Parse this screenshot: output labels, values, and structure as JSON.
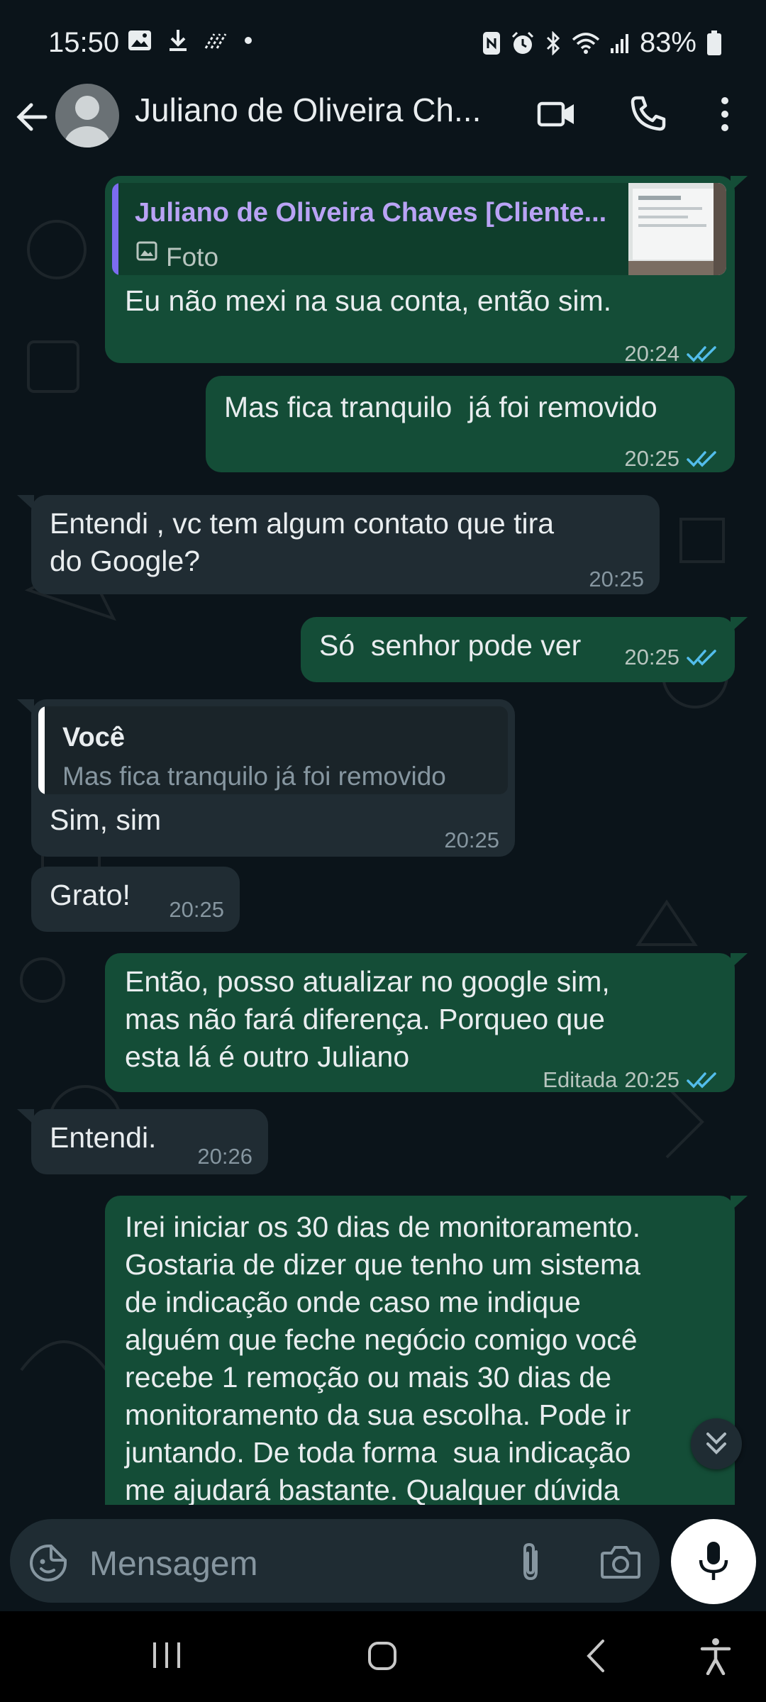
{
  "status_bar": {
    "time": "15:50",
    "battery": "83%",
    "icons": [
      "gallery-icon",
      "download-icon",
      "data-saver-icon",
      "dot-icon",
      "nfc-icon",
      "alarm-icon",
      "bluetooth-icon",
      "wifi-icon",
      "signal-icon",
      "battery-icon"
    ]
  },
  "header": {
    "contact_name": "Juliano de Oliveira Ch...",
    "icons": [
      "back-arrow-icon",
      "avatar-icon",
      "video-call-icon",
      "voice-call-icon",
      "more-options-icon"
    ]
  },
  "messages": [
    {
      "direction": "out",
      "quote": {
        "name": "Juliano de Oliveira Chaves [Cliente...",
        "label": "Foto",
        "name_color": "#b9a3f5",
        "bar_color": "#7c6cf0"
      },
      "text": "Eu não mexi na sua conta, então sim.",
      "time": "20:24",
      "status": "read"
    },
    {
      "direction": "out",
      "text": "Mas fica tranquilo  já foi removido",
      "time": "20:25",
      "status": "read"
    },
    {
      "direction": "in",
      "text": "Entendi , vc tem algum contato que tira\ndo Google?",
      "time": "20:25"
    },
    {
      "direction": "out",
      "text": "Só  senhor pode ver",
      "time": "20:25",
      "status": "read"
    },
    {
      "direction": "in",
      "quote": {
        "name": "Você",
        "text": "Mas fica tranquilo  já foi removido",
        "name_color": "#e9edef",
        "bar_color": "#ffffff"
      },
      "text": "Sim, sim",
      "time": "20:25"
    },
    {
      "direction": "in",
      "text": "Grato!",
      "time": "20:25"
    },
    {
      "direction": "out",
      "text": "Então, posso atualizar no google sim,\nmas não fará diferença. Porqueo que\nesta lá é outro Juliano",
      "edited_label": "Editada",
      "time": "20:25",
      "status": "read"
    },
    {
      "direction": "in",
      "text": "Entendi.",
      "time": "20:26"
    },
    {
      "direction": "out",
      "text": "Irei iniciar os 30 dias de monitoramento.\nGostaria de dizer que tenho um sistema\nde indicação onde caso me indique\nalguém que feche negócio comigo você\nrecebe 1 remoção ou mais 30 dias de\nmonitoramento da sua escolha. Pode ir\njuntando. De toda forma  sua indicação\nme ajudará bastante. Qualquer dúvida"
    }
  ],
  "input": {
    "placeholder": "Mensagem",
    "icons": [
      "sticker-icon",
      "attach-icon",
      "camera-icon",
      "mic-icon"
    ]
  },
  "colors": {
    "background": "#0b141a",
    "outgoing_bubble": "#144d37",
    "incoming_bubble": "#202c33",
    "read_ticks": "#53bdeb"
  }
}
